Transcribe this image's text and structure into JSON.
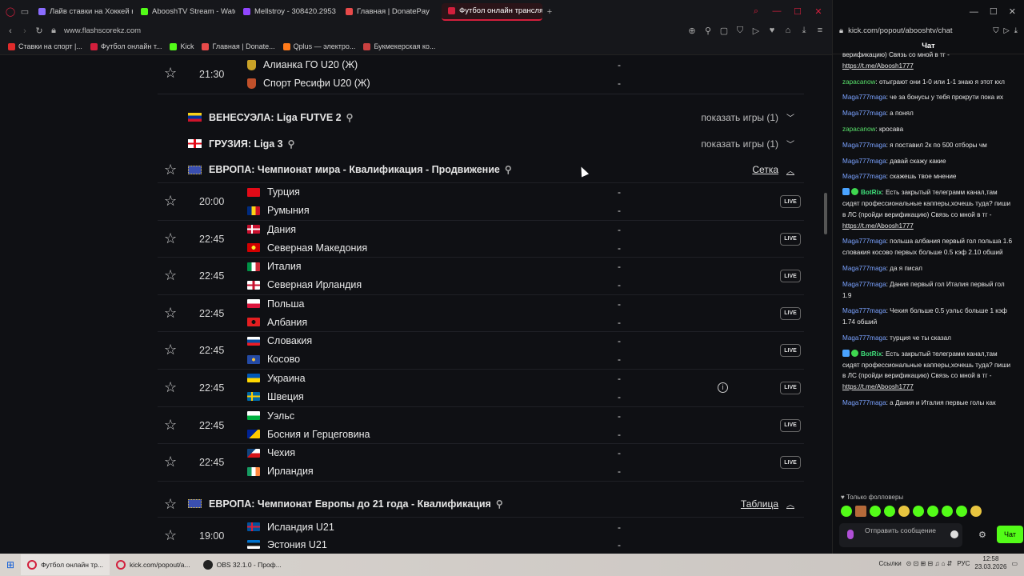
{
  "browser": {
    "tabs": [
      {
        "label": "Лайв ставки на Хоккей в",
        "color": "#8a6cff"
      },
      {
        "label": "AbooshTV Stream - Watc",
        "color": "#53fc18"
      },
      {
        "label": "Mellstroy - 308420.2953",
        "color": "#9146ff"
      },
      {
        "label": "Главная | DonatePay",
        "color": "#e84a4a"
      },
      {
        "label": "Футбол онлайн трансляц",
        "color": "#d21f3c"
      }
    ],
    "new_tab": "+",
    "url": "www.flashscorekz.com",
    "bookmarks": [
      {
        "label": "Ставки на спорт |...",
        "color": "#e02b2b"
      },
      {
        "label": "Футбол онлайн т...",
        "color": "#d21f3c"
      },
      {
        "label": "Kick",
        "color": "#53fc18"
      },
      {
        "label": "Главная | Donate...",
        "color": "#e84a4a"
      },
      {
        "label": "Qplus — электро...",
        "color": "#ff7a1a"
      },
      {
        "label": "Букмекерская ко...",
        "color": "#c94040"
      }
    ]
  },
  "top_match": {
    "time": "21:30",
    "home": "Алианка ГО U20 (Ж)",
    "away": "Спорт Ресифи U20 (Ж)",
    "score_home": "-",
    "score_away": "-"
  },
  "leagues_collapsed": [
    {
      "name": "ВЕНЕСУЭЛА: Liga FUTVE 2",
      "action": "показать игры (1)"
    },
    {
      "name": "ГРУЗИЯ: Liga 3",
      "action": "показать игры (1)"
    }
  ],
  "league_main": {
    "name": "ЕВРОПА: Чемпионат мира - Квалификация - Продвижение",
    "action": "Сетка"
  },
  "matches": [
    {
      "time": "20:00",
      "home": "Турция",
      "away": "Румыния",
      "live": "LIVE"
    },
    {
      "time": "22:45",
      "home": "Дания",
      "away": "Северная Македония",
      "live": "LIVE"
    },
    {
      "time": "22:45",
      "home": "Италия",
      "away": "Северная Ирландия",
      "live": "LIVE"
    },
    {
      "time": "22:45",
      "home": "Польша",
      "away": "Албания",
      "live": "LIVE"
    },
    {
      "time": "22:45",
      "home": "Словакия",
      "away": "Косово",
      "live": "LIVE"
    },
    {
      "time": "22:45",
      "home": "Украина",
      "away": "Швеция",
      "live": "LIVE"
    },
    {
      "time": "22:45",
      "home": "Уэльс",
      "away": "Босния и Герцеговина",
      "live": "LIVE"
    },
    {
      "time": "22:45",
      "home": "Чехия",
      "away": "Ирландия",
      "live": "LIVE"
    }
  ],
  "dash": "-",
  "league_u21": {
    "name": "ЕВРОПА: Чемпионат Европы до 21 года - Квалификация",
    "action": "Таблица"
  },
  "u21_match": {
    "time": "19:00",
    "home": "Исландия U21",
    "away": "Эстония U21"
  },
  "chat": {
    "url": "kick.com/popout/abooshtv/chat",
    "title": "Чат",
    "messages": [
      {
        "user": "",
        "text": "верификацию) Связь со мной в тг -",
        "link": "https://t.me/Aboosh1777"
      },
      {
        "user": "zapacanow",
        "text": ": отыграют они 1-0 или 1-1 знаю я этот кхл"
      },
      {
        "user": "Maga777maga",
        "text": ": че за бонусы у тебя прокрути пока их"
      },
      {
        "user": "Maga777maga",
        "text": ": а понял"
      },
      {
        "user": "zapacanow",
        "text": ": кросава"
      },
      {
        "user": "Maga777maga",
        "text": ": я поставил 2к по 500 отборы чм"
      },
      {
        "user": "Maga777maga",
        "text": ": давай скажу какие"
      },
      {
        "user": "Maga777maga",
        "text": ": скажешь твое мнение"
      },
      {
        "user": "BotRix",
        "text": ": Есть закрытый телеграмм канал,там сидят профессиональные капперы,хочешь туда? пиши в ЛС (пройди верификацию) Связь со мной в тг -",
        "link": "https://t.me/Aboosh1777"
      },
      {
        "user": "Maga777maga",
        "text": ": польша албания первый гол польша 1.6 словакия косово первых больше 0.5 кэф 2.10 обший"
      },
      {
        "user": "Maga777maga",
        "text": ": да я писал"
      },
      {
        "user": "Maga777maga",
        "text": ": Дания первый гол Италия первый гол 1.9"
      },
      {
        "user": "Maga777maga",
        "text": ": Чехия больше 0.5 уэльс больше 1 кэф 1.74 обший"
      },
      {
        "user": "Maga777maga",
        "text": ": турция че ты сказал"
      },
      {
        "user": "BotRix",
        "text": ": Есть закрытый телеграмм канал,там сидят профессиональные капперы,хочешь туда? пиши в ЛС (пройди верификацию) Связь со мной в тг -",
        "link": "https://t.me/Aboosh1777"
      },
      {
        "user": "Maga777maga",
        "text": ": а Дания и Италия первые голы как"
      }
    ],
    "followers_only": "Только фолловеры",
    "placeholder": "Отправить сообщение",
    "send_label": "Чат"
  },
  "taskbar": {
    "apps": [
      "Футбол онлайн тр...",
      "kick.com/popout/a...",
      "OBS 32.1.0 - Проф..."
    ],
    "links_label": "Ссылки",
    "lang": "РУС",
    "time": "12:58",
    "date": "23.03.2026"
  }
}
